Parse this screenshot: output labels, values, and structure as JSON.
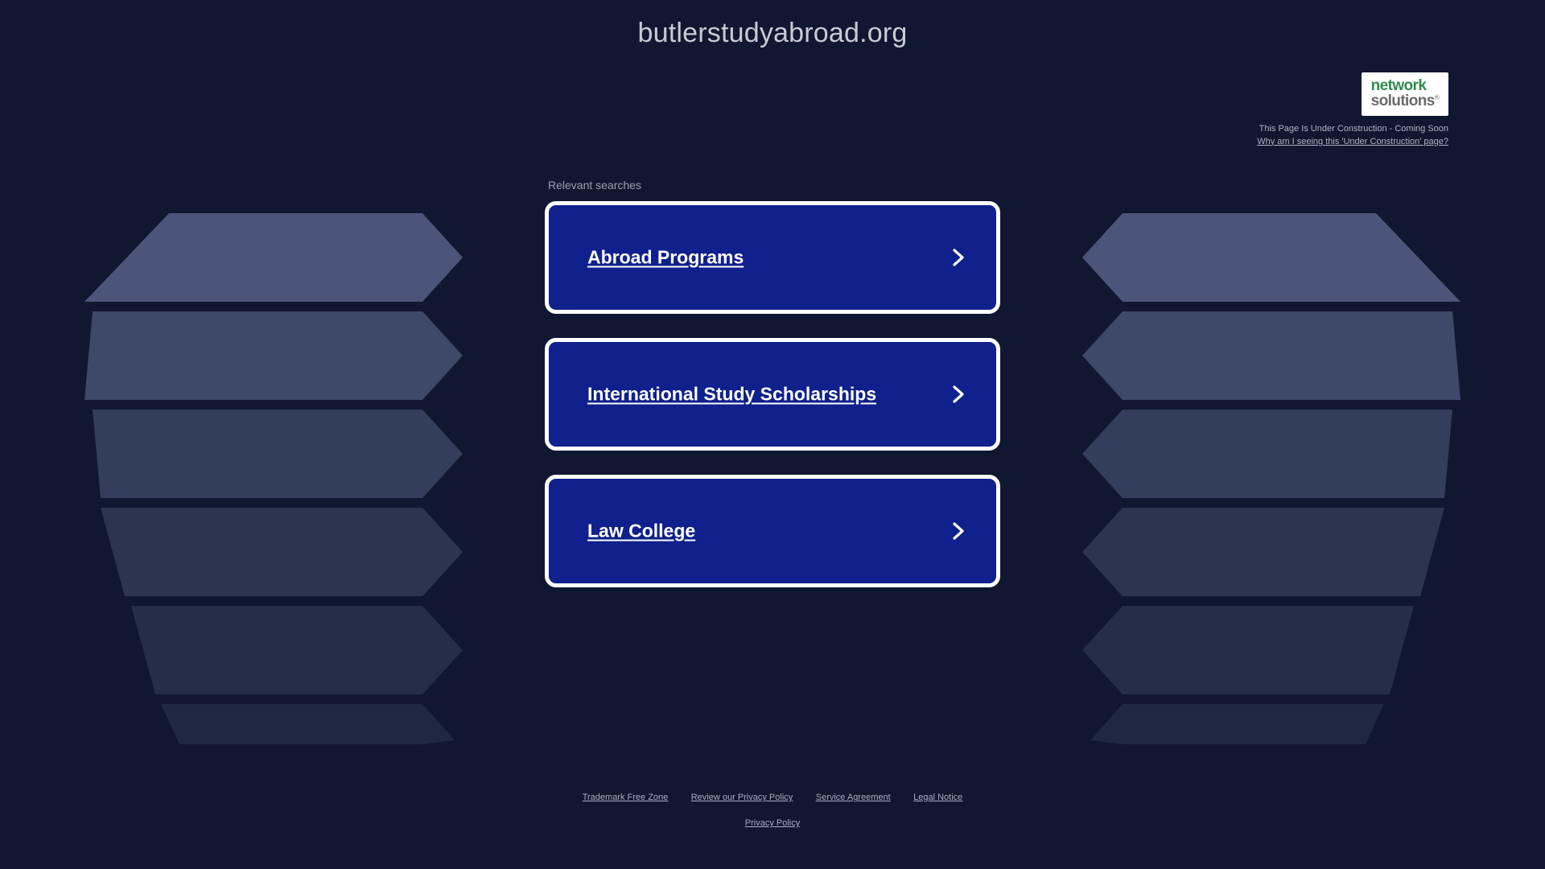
{
  "page": {
    "domain_title": "butlerstudyabroad.org",
    "background_color": "#101730",
    "card_color": "#10208C",
    "accent_border_color": "#ffffff"
  },
  "brand": {
    "logo_line1": "network",
    "logo_line2": "solutions",
    "logo_tm": "®",
    "logo_green": "#2f8b4e",
    "logo_gray": "#6a6a6a",
    "status_text": "This Page Is Under Construction - Coming Soon",
    "help_link": "Why am I seeing this 'Under Construction' page?"
  },
  "main": {
    "relevant_label": "Relevant searches",
    "cards": [
      {
        "label": "Abroad Programs",
        "chevron": "chevron-right-icon"
      },
      {
        "label": "International Study Scholarships",
        "chevron": "chevron-right-icon"
      },
      {
        "label": "Law College",
        "chevron": "chevron-right-icon"
      }
    ]
  },
  "footer": {
    "row1": [
      "Trademark Free Zone",
      "Review our Privacy Policy",
      "Service Agreement",
      "Legal Notice"
    ],
    "row2": [
      "Privacy Policy"
    ]
  },
  "decoration": {
    "name": "stacked-chevron-bands",
    "band_colors": [
      "#4B5579",
      "#3E4868",
      "#333D5C",
      "#2B3550",
      "#242E47",
      "#1E2840"
    ]
  }
}
